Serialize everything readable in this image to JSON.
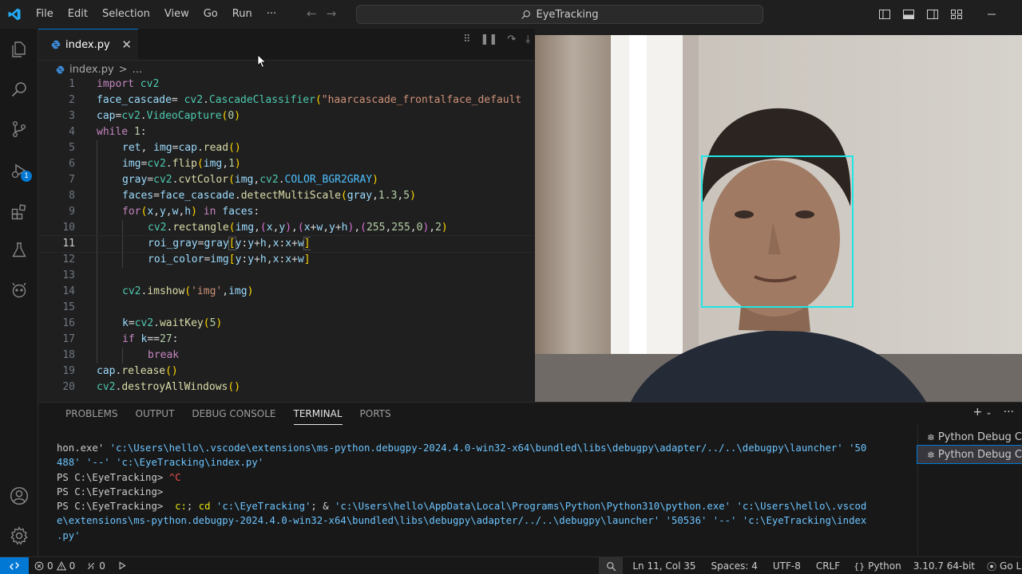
{
  "menu": [
    "File",
    "Edit",
    "Selection",
    "View",
    "Go",
    "Run",
    "···"
  ],
  "command_center": "EyeTracking",
  "tab": {
    "name": "index.py",
    "close": "✕"
  },
  "breadcrumb": {
    "file": "index.py",
    "sep": ">",
    "more": "..."
  },
  "debug_badge": "1",
  "code_lines": [
    {
      "n": "1",
      "indent": 0,
      "html": "<span class='kw'>import</span> <span class='cl'>cv2</span>"
    },
    {
      "n": "2",
      "indent": 0,
      "html": "<span class='vr'>face_cascade</span><span class='pl'>= </span><span class='cl'>cv2</span><span class='pl'>.</span><span class='cl'>CascadeClassifier</span><span class='br1'>(</span><span class='st'>\"haarcascade_frontalface_default</span>"
    },
    {
      "n": "3",
      "indent": 0,
      "html": "<span class='vr'>cap</span><span class='pl'>=</span><span class='cl'>cv2</span><span class='pl'>.</span><span class='cl'>VideoCapture</span><span class='br1'>(</span><span class='nm'>0</span><span class='br1'>)</span>"
    },
    {
      "n": "4",
      "indent": 0,
      "html": "<span class='kw'>while</span> <span class='nm'>1</span><span class='pl'>:</span>"
    },
    {
      "n": "5",
      "indent": 1,
      "html": "<span class='vr'>ret</span><span class='pl'>, </span><span class='vr'>img</span><span class='pl'>=</span><span class='vr'>cap</span><span class='pl'>.</span><span class='fn'>read</span><span class='br1'>()</span>"
    },
    {
      "n": "6",
      "indent": 1,
      "html": "<span class='vr'>img</span><span class='pl'>=</span><span class='cl'>cv2</span><span class='pl'>.</span><span class='fn'>flip</span><span class='br1'>(</span><span class='vr'>img</span><span class='pl'>,</span><span class='nm'>1</span><span class='br1'>)</span>"
    },
    {
      "n": "7",
      "indent": 1,
      "html": "<span class='vr'>gray</span><span class='pl'>=</span><span class='cl'>cv2</span><span class='pl'>.</span><span class='fn'>cvtColor</span><span class='br1'>(</span><span class='vr'>img</span><span class='pl'>,</span><span class='cl'>cv2</span><span class='pl'>.</span><span class='mb'>COLOR_BGR2GRAY</span><span class='br1'>)</span>"
    },
    {
      "n": "8",
      "indent": 1,
      "html": "<span class='vr'>faces</span><span class='pl'>=</span><span class='vr'>face_cascade</span><span class='pl'>.</span><span class='fn'>detectMultiScale</span><span class='br1'>(</span><span class='vr'>gray</span><span class='pl'>,</span><span class='nm'>1.3</span><span class='pl'>,</span><span class='nm'>5</span><span class='br1'>)</span>"
    },
    {
      "n": "9",
      "indent": 1,
      "html": "<span class='kw'>for</span><span class='br1'>(</span><span class='vr'>x</span><span class='pl'>,</span><span class='vr'>y</span><span class='pl'>,</span><span class='vr'>w</span><span class='pl'>,</span><span class='vr'>h</span><span class='br1'>)</span> <span class='kw'>in</span> <span class='vr'>faces</span><span class='pl'>:</span>"
    },
    {
      "n": "10",
      "indent": 2,
      "html": "<span class='cl'>cv2</span><span class='pl'>.</span><span class='fn'>rectangle</span><span class='br1'>(</span><span class='vr'>img</span><span class='pl'>,</span><span class='br2'>(</span><span class='vr'>x</span><span class='pl'>,</span><span class='vr'>y</span><span class='br2'>)</span><span class='pl'>,</span><span class='br2'>(</span><span class='vr'>x</span><span class='pl'>+</span><span class='vr'>w</span><span class='pl'>,</span><span class='vr'>y</span><span class='pl'>+</span><span class='vr'>h</span><span class='br2'>)</span><span class='pl'>,</span><span class='br2'>(</span><span class='nm'>255</span><span class='pl'>,</span><span class='nm'>255</span><span class='pl'>,</span><span class='nm'>0</span><span class='br2'>)</span><span class='pl'>,</span><span class='nm'>2</span><span class='br1'>)</span>"
    },
    {
      "n": "11",
      "indent": 2,
      "current": true,
      "html": "<span class='vr'>roi_gray</span><span class='pl'>=</span><span class='vr'>gray</span><span class='br1' style='outline:1px solid #5a5a5a'>[</span><span class='vr'>y</span><span class='pl'>:</span><span class='vr'>y</span><span class='pl'>+</span><span class='vr'>h</span><span class='pl'>,</span><span class='vr'>x</span><span class='pl'>:</span><span class='vr'>x</span><span class='pl'>+</span><span class='vr'>w</span><span class='br1' style='outline:1px solid #5a5a5a'>]</span>"
    },
    {
      "n": "12",
      "indent": 2,
      "html": "<span class='vr'>roi_color</span><span class='pl'>=</span><span class='vr'>img</span><span class='br1'>[</span><span class='vr'>y</span><span class='pl'>:</span><span class='vr'>y</span><span class='pl'>+</span><span class='vr'>h</span><span class='pl'>,</span><span class='vr'>x</span><span class='pl'>:</span><span class='vr'>x</span><span class='pl'>+</span><span class='vr'>w</span><span class='br1'>]</span>"
    },
    {
      "n": "13",
      "indent": 1,
      "html": ""
    },
    {
      "n": "14",
      "indent": 1,
      "html": "<span class='cl'>cv2</span><span class='pl'>.</span><span class='fn'>imshow</span><span class='br1'>(</span><span class='st'>'img'</span><span class='pl'>,</span><span class='vr'>img</span><span class='br1'>)</span>"
    },
    {
      "n": "15",
      "indent": 1,
      "html": ""
    },
    {
      "n": "16",
      "indent": 1,
      "html": "<span class='vr'>k</span><span class='pl'>=</span><span class='cl'>cv2</span><span class='pl'>.</span><span class='fn'>waitKey</span><span class='br1'>(</span><span class='nm'>5</span><span class='br1'>)</span>"
    },
    {
      "n": "17",
      "indent": 1,
      "html": "<span class='kw'>if</span> <span class='vr'>k</span><span class='pl'>==</span><span class='nm'>27</span><span class='pl'>:</span>"
    },
    {
      "n": "18",
      "indent": 2,
      "html": "<span class='kw'>break</span>"
    },
    {
      "n": "19",
      "indent": 0,
      "html": "<span class='vr'>cap</span><span class='pl'>.</span><span class='fn'>release</span><span class='br1'>()</span>"
    },
    {
      "n": "20",
      "indent": 0,
      "html": "<span class='cl'>cv2</span><span class='pl'>.</span><span class='fn'>destroyAllWindows</span><span class='br1'>()</span>"
    }
  ],
  "panel_tabs": [
    "PROBLEMS",
    "OUTPUT",
    "DEBUG CONSOLE",
    "TERMINAL",
    "PORTS"
  ],
  "panel_active": "TERMINAL",
  "terminal_lines": [
    "hon.exe' <span class='t-str'>'c:\\Users\\hello\\.vscode\\extensions\\ms-python.debugpy-2024.4.0-win32-x64\\bundled\\libs\\debugpy\\adapter/../..\\debugpy\\launcher'</span> <span class='t-str'>'50</span>",
    "<span class='t-str'>488'</span> <span class='t-str'>'--'</span> <span class='t-str'>'c:\\EyeTracking\\index.py'</span>",
    "PS C:\\EyeTracking> <span class='t-red'>^C</span>",
    "PS C:\\EyeTracking>",
    "PS C:\\EyeTracking>  <span class='t-yel'>c:</span>; <span class='t-yel'>cd</span> <span class='t-str'>'c:\\EyeTracking'</span>; & <span class='t-str'>'c:\\Users\\hello\\AppData\\Local\\Programs\\Python\\Python310\\python.exe'</span> <span class='t-str'>'c:\\Users\\hello\\.vscod</span>",
    "<span class='t-str'>e\\extensions\\ms-python.debugpy-2024.4.0-win32-x64\\bundled\\libs\\debugpy\\adapter/../..\\debugpy\\launcher'</span> <span class='t-str'>'50536'</span> <span class='t-str'>'--'</span> <span class='t-str'>'c:\\EyeTracking\\index</span>",
    "<span class='t-str'>.py'</span>"
  ],
  "terminal_list": [
    "Python Debug C",
    "Python Debug C"
  ],
  "status": {
    "errors": "0",
    "warnings": "0",
    "ports": "0",
    "position": "Ln 11, Col 35",
    "spaces": "Spaces: 4",
    "encoding": "UTF-8",
    "eol": "CRLF",
    "language": "Python",
    "interpreter": "3.10.7 64-bit",
    "golive": "Go Li"
  },
  "colors": {
    "accent": "#0078d4",
    "face_box": "#1fe6e6"
  }
}
